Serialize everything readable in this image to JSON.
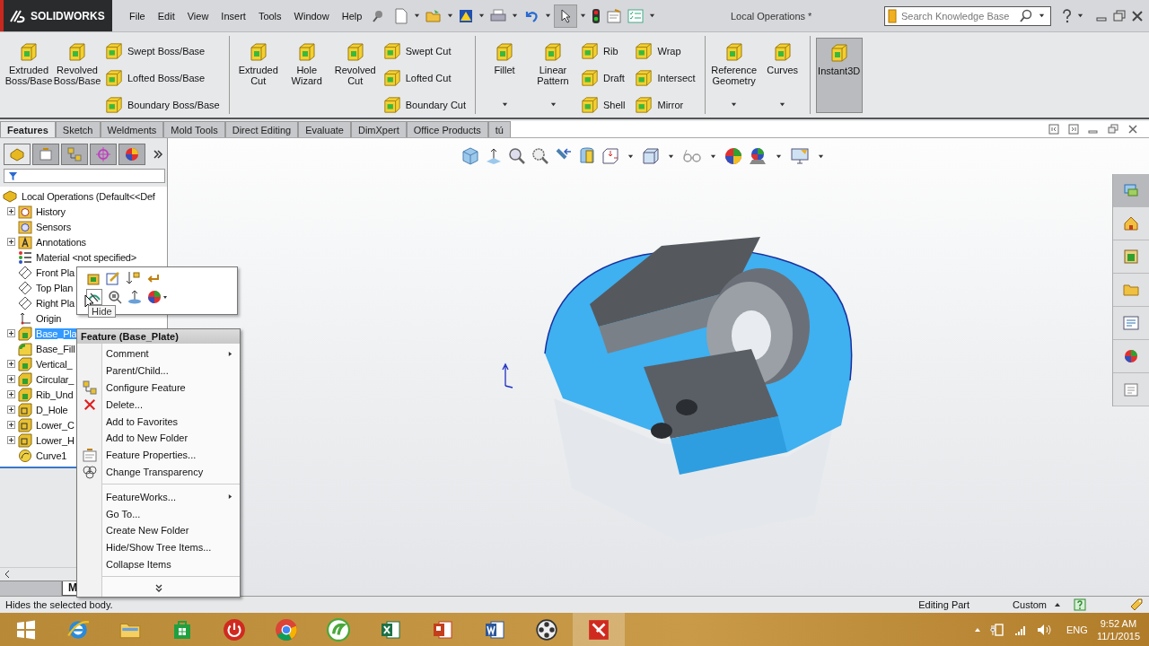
{
  "app": {
    "logo_text": "SOLIDWORKS",
    "menus": [
      "File",
      "Edit",
      "View",
      "Insert",
      "Tools",
      "Window",
      "Help"
    ],
    "document_title": "Local Operations *",
    "search": {
      "placeholder": "Search Knowledge Base"
    }
  },
  "ribbon": {
    "groups": [
      {
        "columns": [
          {
            "kind": "large",
            "label": "Extruded Boss/Base",
            "dropdown": false,
            "selected": false
          },
          {
            "kind": "large",
            "label": "Revolved Boss/Base",
            "dropdown": false,
            "selected": false
          },
          {
            "kind": "stack",
            "items": [
              "Swept Boss/Base",
              "Lofted Boss/Base",
              "Boundary Boss/Base"
            ]
          }
        ]
      },
      {
        "columns": [
          {
            "kind": "large",
            "label": "Extruded Cut",
            "dropdown": false,
            "selected": false
          },
          {
            "kind": "large",
            "label": "Hole Wizard",
            "dropdown": false,
            "selected": false
          },
          {
            "kind": "large",
            "label": "Revolved Cut",
            "dropdown": false,
            "selected": false
          },
          {
            "kind": "stack",
            "items": [
              "Swept Cut",
              "Lofted Cut",
              "Boundary Cut"
            ]
          }
        ]
      },
      {
        "columns": [
          {
            "kind": "large",
            "label": "Fillet",
            "dropdown": true,
            "selected": false
          },
          {
            "kind": "large",
            "label": "Linear Pattern",
            "dropdown": true,
            "selected": false
          },
          {
            "kind": "stack",
            "items": [
              "Rib",
              "Draft",
              "Shell"
            ]
          },
          {
            "kind": "stack",
            "items": [
              "Wrap",
              "Intersect",
              "Mirror"
            ]
          }
        ]
      },
      {
        "columns": [
          {
            "kind": "large",
            "label": "Reference Geometry",
            "dropdown": true,
            "selected": false
          },
          {
            "kind": "large",
            "label": "Curves",
            "dropdown": true,
            "selected": false
          }
        ]
      },
      {
        "columns": [
          {
            "kind": "large",
            "label": "Instant3D",
            "dropdown": false,
            "selected": true
          }
        ]
      }
    ]
  },
  "tabs": [
    {
      "label": "Features",
      "selected": true
    },
    {
      "label": "Sketch",
      "selected": false
    },
    {
      "label": "Weldments",
      "selected": false
    },
    {
      "label": "Mold Tools",
      "selected": false
    },
    {
      "label": "Direct Editing",
      "selected": false
    },
    {
      "label": "Evaluate",
      "selected": false
    },
    {
      "label": "DimXpert",
      "selected": false
    },
    {
      "label": "Office Products",
      "selected": false
    },
    {
      "label": "tú",
      "selected": false
    }
  ],
  "tree": {
    "label": "Local Operations  (Default<<Def",
    "children": [
      {
        "label": "History",
        "kind": "history",
        "collapsed": true,
        "selected": false
      },
      {
        "label": "Sensors",
        "kind": "sensor",
        "collapsed": false,
        "selected": false
      },
      {
        "label": "Annotations",
        "kind": "annotation",
        "collapsed": true,
        "selected": false
      },
      {
        "label": "Material <not specified>",
        "kind": "material",
        "collapsed": false,
        "selected": false
      },
      {
        "label": "Front Pla",
        "kind": "plane",
        "collapsed": false,
        "selected": false
      },
      {
        "label": "Top Plan",
        "kind": "plane",
        "collapsed": false,
        "selected": false
      },
      {
        "label": "Right Pla",
        "kind": "plane",
        "collapsed": false,
        "selected": false
      },
      {
        "label": "Origin",
        "kind": "origin",
        "collapsed": false,
        "selected": false
      },
      {
        "label": "Base_Pla",
        "kind": "feature",
        "collapsed": true,
        "selected": true
      },
      {
        "label": "Base_Fill",
        "kind": "fillet",
        "collapsed": false,
        "selected": false
      },
      {
        "label": "Vertical_",
        "kind": "feature",
        "collapsed": true,
        "selected": false
      },
      {
        "label": "Circular_",
        "kind": "feature",
        "collapsed": true,
        "selected": false
      },
      {
        "label": "Rib_Und",
        "kind": "feature",
        "collapsed": true,
        "selected": false
      },
      {
        "label": "D_Hole",
        "kind": "cut",
        "collapsed": true,
        "selected": false
      },
      {
        "label": "Lower_C",
        "kind": "cut",
        "collapsed": true,
        "selected": false
      },
      {
        "label": "Lower_H",
        "kind": "cut",
        "collapsed": true,
        "selected": false
      },
      {
        "label": "Curve1",
        "kind": "curve",
        "collapsed": false,
        "selected": false
      }
    ]
  },
  "panel_tab": "M",
  "tooltip": "Hide",
  "context_menu": {
    "title": "Feature (Base_Plate)",
    "sections": [
      [
        {
          "label": "Comment",
          "kind": "plain",
          "submenu": true
        },
        {
          "label": "Parent/Child...",
          "kind": "plain",
          "submenu": false
        },
        {
          "label": "Configure Feature",
          "kind": "configure",
          "submenu": false
        },
        {
          "label": "Delete...",
          "kind": "delete",
          "submenu": false
        },
        {
          "label": "Add to Favorites",
          "kind": "plain",
          "submenu": false
        },
        {
          "label": "Add to New Folder",
          "kind": "plain",
          "submenu": false
        },
        {
          "label": "Feature Properties...",
          "kind": "properties",
          "submenu": false
        },
        {
          "label": "Change Transparency",
          "kind": "transparency",
          "submenu": false
        }
      ],
      [
        {
          "label": "FeatureWorks...",
          "kind": "plain",
          "submenu": true
        },
        {
          "label": "Go To...",
          "kind": "plain",
          "submenu": false
        },
        {
          "label": "Create New Folder",
          "kind": "plain",
          "submenu": false
        },
        {
          "label": "Hide/Show Tree Items...",
          "kind": "plain",
          "submenu": false
        },
        {
          "label": "Collapse Items",
          "kind": "plain",
          "submenu": false
        }
      ]
    ]
  },
  "status_bar": {
    "message": "Hides the selected body.",
    "mode": "Editing Part",
    "units": "Custom"
  },
  "tray": {
    "language": "ENG",
    "time": "9:52 AM",
    "date": "11/1/2015"
  }
}
